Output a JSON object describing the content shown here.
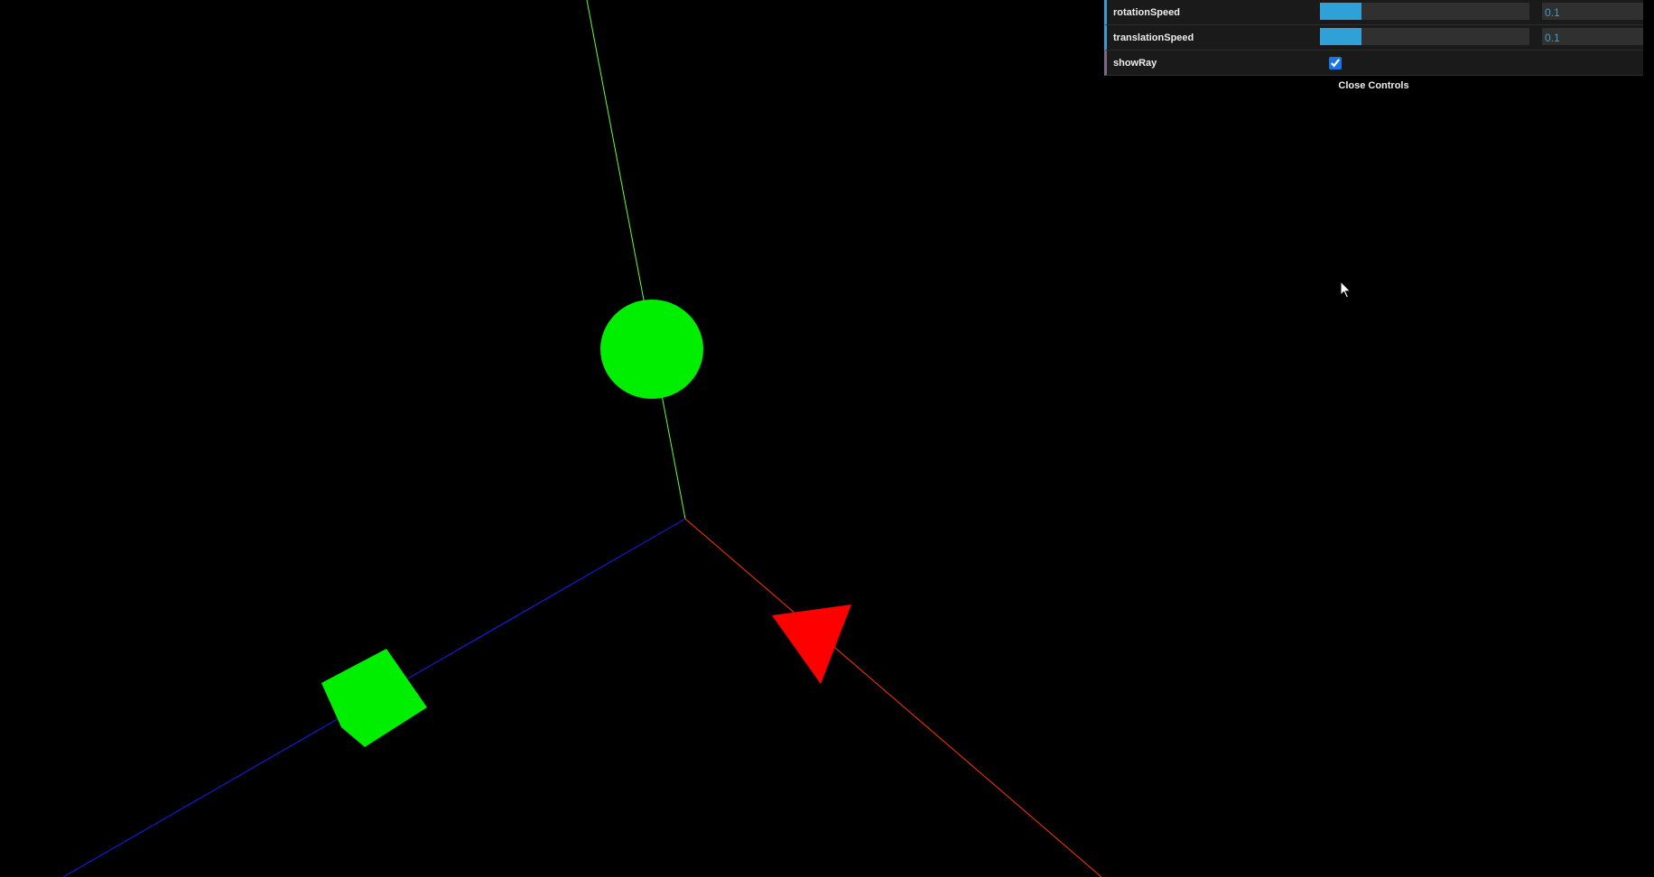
{
  "gui": {
    "controls": [
      {
        "label": "rotationSpeed",
        "value": "0.1",
        "fraction": 0.2
      },
      {
        "label": "translationSpeed",
        "value": "0.1",
        "fraction": 0.2
      }
    ],
    "show_ray": {
      "label": "showRay",
      "checked": true
    },
    "close_label": "Close Controls"
  },
  "scene": {
    "background": "#000000",
    "axis_colors": {
      "x": "#ff3300",
      "y": "#66ff33",
      "z": "#1a1aff"
    },
    "object_colors": {
      "sphere": "#00ee00",
      "cube": "#00ee00",
      "cone": "#ff0000"
    },
    "accent": "#2fa1d6"
  }
}
